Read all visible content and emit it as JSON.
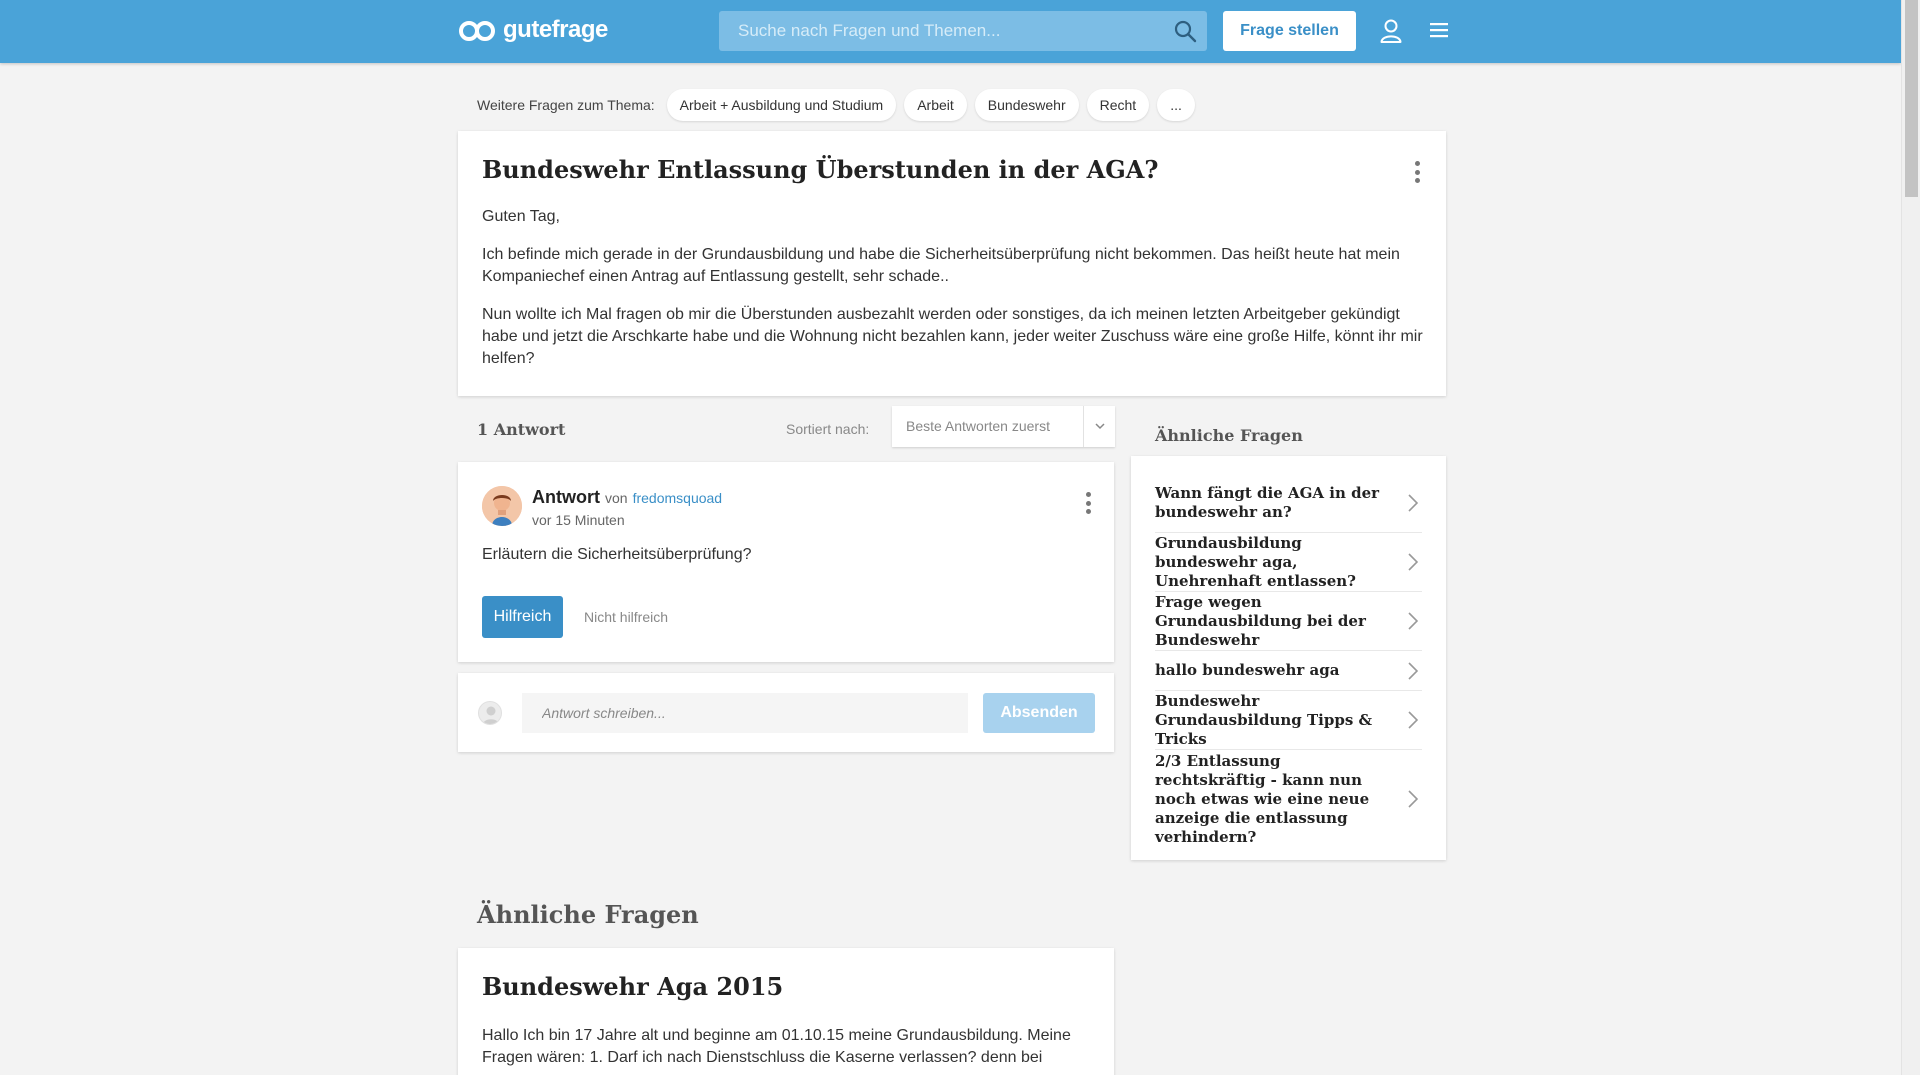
{
  "header": {
    "logo_text": "gutefrage",
    "search_placeholder": "Suche nach Fragen und Themen...",
    "ask_button": "Frage stellen"
  },
  "topics": {
    "label": "Weitere Fragen zum Thema:",
    "chips": [
      "Arbeit + Ausbildung und Studium",
      "Arbeit",
      "Bundeswehr",
      "Recht",
      "..."
    ]
  },
  "question": {
    "title": "Bundeswehr Entlassung Überstunden in der AGA?",
    "paragraphs": [
      "Guten Tag,",
      "Ich befinde mich gerade in der Grundausbildung und habe die Sicherheitsüberprüfung nicht bekommen. Das heißt heute hat mein Kompaniechef einen Antrag auf Entlassung gestellt, sehr schade..",
      "Nun wollte ich Mal fragen ob mir die Überstunden ausbezahlt werden oder sonstiges, da ich meinen letzten Arbeitgeber gekündigt habe und jetzt die Arschkarte habe und die Wohnung nicht bezahlen kann, jeder weiter Zuschuss wäre eine große Hilfe, könnt ihr mir helfen?"
    ]
  },
  "answers": {
    "count_label": "1 Antwort",
    "sort_label": "Sortiert nach:",
    "sort_value": "Beste Antworten zuerst"
  },
  "answer": {
    "title": "Antwort",
    "von": "von",
    "author": "fredomsquoad",
    "time": "vor 15 Minuten",
    "body": "Erläutern die Sicherheitsüberprüfung?",
    "helpful": "Hilfreich",
    "not_helpful": "Nicht hilfreich"
  },
  "reply": {
    "placeholder": "Antwort schreiben...",
    "send": "Absenden"
  },
  "similar": {
    "heading": "Ähnliche Fragen",
    "card_title": "Bundeswehr Aga 2015",
    "card_text": "Hallo Ich bin 17 Jahre alt und beginne am 01.10.15 meine Grundausbildung. Meine Fragen wären: 1. Darf ich nach Dienstschluss die Kaserne verlassen? denn bei"
  },
  "sidebar": {
    "heading": "Ähnliche Fragen",
    "items": [
      "Wann fängt die AGA in der bundeswehr an?",
      "Grundausbildung bundeswehr aga, Unehrenhaft entlassen?",
      "Frage wegen Grundausbildung bei der Bundeswehr",
      "hallo bundeswehr aga",
      "Bundeswehr Grundausbildung Tipps & Tricks",
      "2/3 Entlassung rechtskräftig - kann nun noch etwas wie eine neue anzeige die entlassung verhindern?"
    ]
  },
  "colors": {
    "brand": "#4aa3d8",
    "link": "#3a8fc7",
    "helpful_button": "#3a8fc7",
    "send_button_disabled": "#a8d2ee"
  },
  "icons": [
    "logo-icon",
    "search-icon",
    "user-icon",
    "menu-icon",
    "more-options-icon",
    "chevron-down-icon",
    "chevron-right-icon",
    "avatar"
  ]
}
